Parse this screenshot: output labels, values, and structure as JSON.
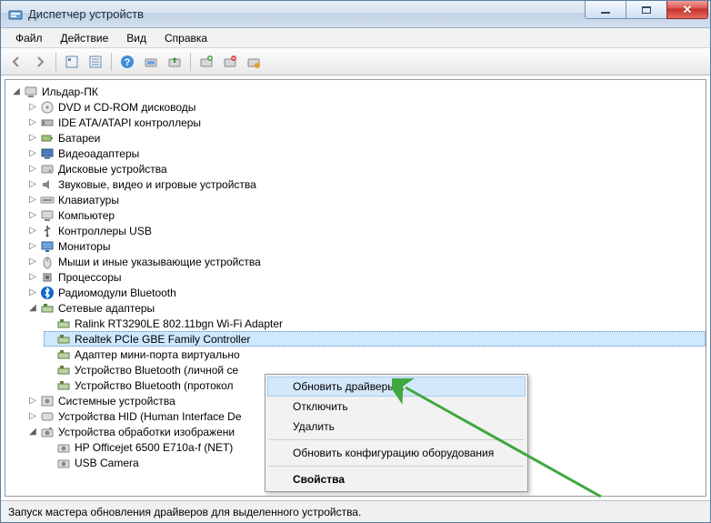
{
  "window": {
    "title": "Диспетчер устройств"
  },
  "menu": {
    "file": "Файл",
    "action": "Действие",
    "view": "Вид",
    "help": "Справка"
  },
  "toolbar": {
    "back": "back-icon",
    "forward": "forward-icon",
    "show_hidden": "show-hidden-icon",
    "properties": "properties-icon",
    "help": "help-icon",
    "scan": "scan-hardware-icon",
    "uninstall": "uninstall-icon",
    "update_driver": "update-driver-icon",
    "disable": "disable-icon",
    "enable": "enable-icon"
  },
  "tree": {
    "root": "Ильдар-ПК",
    "categories": [
      {
        "label": "DVD и CD-ROM дисководы",
        "icon": "disc-drive-icon"
      },
      {
        "label": "IDE ATA/ATAPI контроллеры",
        "icon": "ide-controller-icon"
      },
      {
        "label": "Батареи",
        "icon": "battery-icon"
      },
      {
        "label": "Видеоадаптеры",
        "icon": "display-adapter-icon"
      },
      {
        "label": "Дисковые устройства",
        "icon": "disk-icon"
      },
      {
        "label": "Звуковые, видео и игровые устройства",
        "icon": "audio-icon"
      },
      {
        "label": "Клавиатуры",
        "icon": "keyboard-icon"
      },
      {
        "label": "Компьютер",
        "icon": "computer-icon"
      },
      {
        "label": "Контроллеры USB",
        "icon": "usb-icon"
      },
      {
        "label": "Мониторы",
        "icon": "monitor-icon"
      },
      {
        "label": "Мыши и иные указывающие устройства",
        "icon": "mouse-icon"
      },
      {
        "label": "Процессоры",
        "icon": "cpu-icon"
      },
      {
        "label": "Радиомодули Bluetooth",
        "icon": "bluetooth-icon"
      },
      {
        "label": "Сетевые адаптеры",
        "icon": "network-adapter-icon",
        "expanded": true,
        "children": [
          {
            "label": "Ralink RT3290LE 802.11bgn Wi-Fi Adapter"
          },
          {
            "label": "Realtek PCIe GBE Family Controller",
            "selected": true
          },
          {
            "label": "Адаптер мини-порта виртуально"
          },
          {
            "label": "Устройство Bluetooth (личной се"
          },
          {
            "label": "Устройство Bluetooth (протокол"
          }
        ]
      },
      {
        "label": "Системные устройства",
        "icon": "system-icon"
      },
      {
        "label": "Устройства HID (Human Interface De",
        "icon": "hid-icon"
      },
      {
        "label": "Устройства обработки изображени",
        "icon": "imaging-icon",
        "expanded": true,
        "children": [
          {
            "label": "HP Officejet 6500 E710a-f (NET)"
          },
          {
            "label": "USB Camera"
          }
        ]
      }
    ]
  },
  "context_menu": {
    "update_drivers": "Обновить драйверы...",
    "disable": "Отключить",
    "delete": "Удалить",
    "scan": "Обновить конфигурацию оборудования",
    "properties": "Свойства"
  },
  "statusbar": {
    "text": "Запуск мастера обновления драйверов для выделенного устройства."
  }
}
